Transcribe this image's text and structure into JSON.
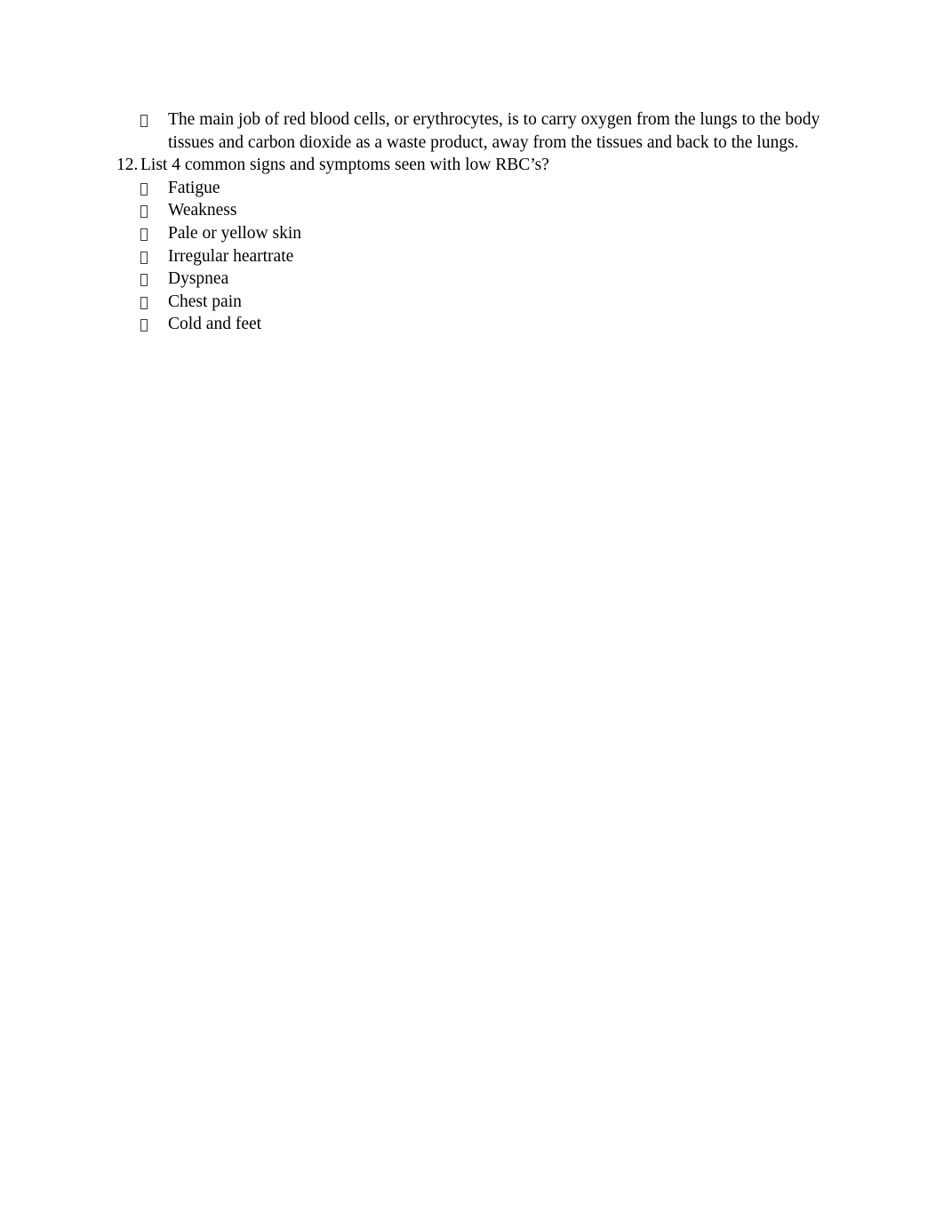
{
  "document": {
    "background_color": "#ffffff",
    "text_color": "#000000",
    "blocks": [
      {
        "type": "bullet",
        "marker": "glyph-box",
        "text": "The main job of red blood cells, or erythrocytes, is to carry oxygen from the lungs to the body tissues and carbon dioxide as a waste product, away from the tissues and back to the lungs."
      },
      {
        "type": "numbered",
        "marker": "12.",
        "text": "List 4 common signs and symptoms seen with low RBC’s?"
      }
    ],
    "symptom_list": {
      "marker": "glyph-box",
      "items": [
        "Fatigue",
        "Weakness",
        "Pale or yellow skin",
        "Irregular heartrate",
        "Dyspnea",
        "Chest pain",
        "Cold and feet"
      ]
    }
  }
}
